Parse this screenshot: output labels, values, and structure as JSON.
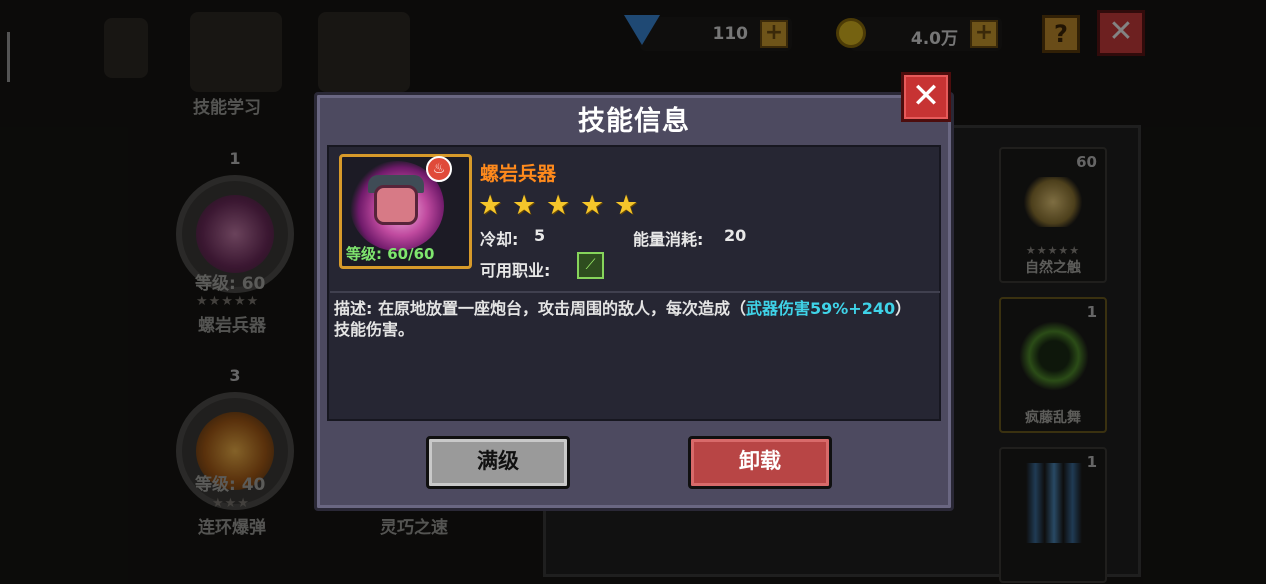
{
  "currency": {
    "gems": "110",
    "gold": "4.0万"
  },
  "top_buttons": {
    "help": "?",
    "close": "✕"
  },
  "left_menu": {
    "skill_learn_label": "技能学习"
  },
  "equipped_skills": [
    {
      "slot": "1",
      "level_text": "等级: 60",
      "stars": "★★★★★",
      "name": "螺岩兵器"
    },
    {
      "slot": "3",
      "level_text": "等级: 40",
      "stars": "★★★",
      "name": "连环爆弹"
    }
  ],
  "middle_label": "灵巧之速",
  "right_cards": [
    {
      "count": "60",
      "stars": "★★★★★",
      "name": "自然之触"
    },
    {
      "count": "1",
      "name": "疯藤乱舞"
    },
    {
      "count": "1",
      "name": ""
    }
  ],
  "modal": {
    "title": "技能信息",
    "close": "✕",
    "skill": {
      "name": "螺岩兵器",
      "star_count": 5,
      "level_text": "等级: 60/60",
      "cooldown_label": "冷却:",
      "cooldown_value": "5",
      "energy_label": "能量消耗:",
      "energy_value": "20",
      "class_label": "可用职业:",
      "description_prefix": "描述: 在原地放置一座炮台，攻击周围的敌人，每次造成（",
      "description_highlight": "武器伤害59%+240",
      "description_suffix": "）技能伤害。"
    },
    "buttons": {
      "max_level": "满级",
      "unload": "卸载"
    }
  },
  "colors": {
    "skill_name": "#ff8a1c",
    "highlight": "#3fd3e8",
    "level_green": "#7fe66e",
    "star_gold": "#f5c62b",
    "close_red": "#c73333"
  }
}
